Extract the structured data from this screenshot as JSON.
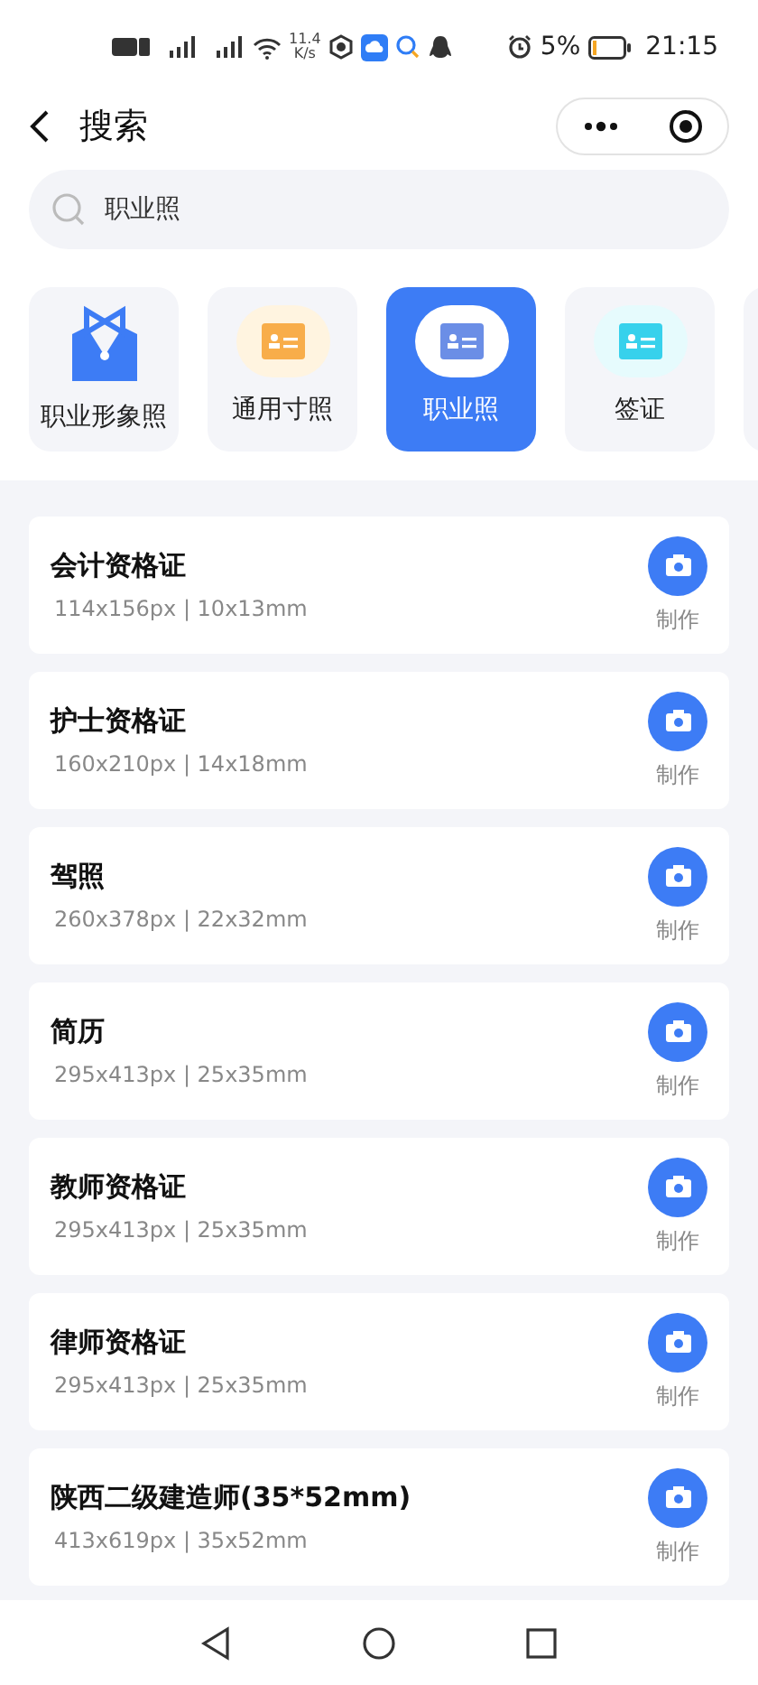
{
  "status_bar": {
    "speed": "11.4",
    "speed_unit": "K/s",
    "battery": "5%",
    "time": "21:15"
  },
  "header": {
    "title": "搜索"
  },
  "search": {
    "value": "职业照"
  },
  "categories": [
    {
      "label": "职业形象照",
      "kind": "suit",
      "selected": false
    },
    {
      "label": "通用寸照",
      "kind": "card-orange",
      "selected": false
    },
    {
      "label": "职业照",
      "kind": "card-blue",
      "selected": true
    },
    {
      "label": "签证",
      "kind": "card-cyan",
      "selected": false
    }
  ],
  "items": [
    {
      "title": "会计资格证",
      "spec": "114x156px | 10x13mm",
      "action": "制作"
    },
    {
      "title": "护士资格证",
      "spec": "160x210px | 14x18mm",
      "action": "制作"
    },
    {
      "title": "驾照",
      "spec": "260x378px | 22x32mm",
      "action": "制作"
    },
    {
      "title": "简历",
      "spec": "295x413px | 25x35mm",
      "action": "制作"
    },
    {
      "title": "教师资格证",
      "spec": "295x413px | 25x35mm",
      "action": "制作"
    },
    {
      "title": "律师资格证",
      "spec": "295x413px | 25x35mm",
      "action": "制作"
    },
    {
      "title": "陕西二级建造师(35*52mm)",
      "spec": "413x619px | 35x52mm",
      "action": "制作"
    }
  ]
}
